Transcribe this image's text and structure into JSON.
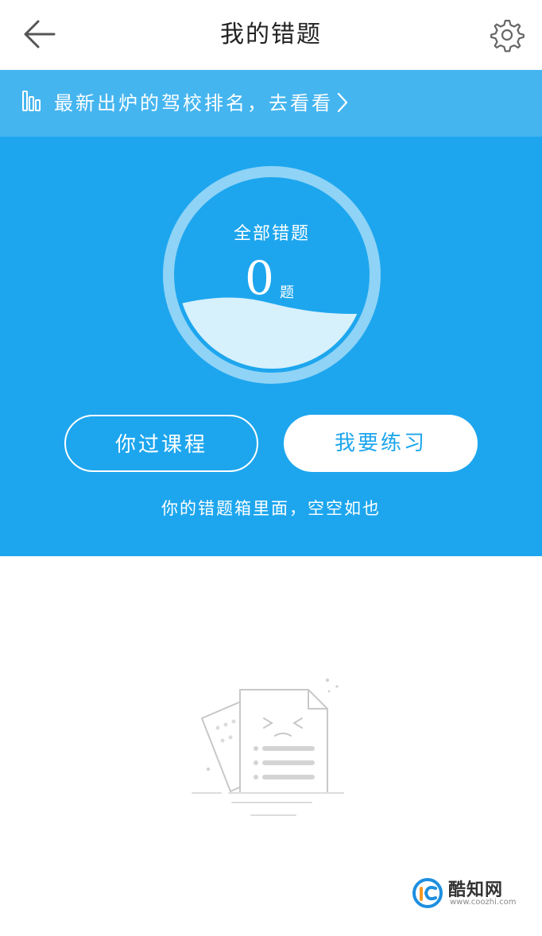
{
  "nav": {
    "title": "我的错题",
    "back_icon": "arrow-left-icon",
    "settings_icon": "gear-icon"
  },
  "banner": {
    "icon": "bar-chart-icon",
    "text": "最新出炉的驾校排名，去看看",
    "chevron_icon": "chevron-right-icon"
  },
  "summary": {
    "label": "全部错题",
    "count": "0",
    "unit": "题"
  },
  "actions": {
    "review_label": "你过课程",
    "practice_label": "我要练习"
  },
  "empty_hint": "你的错题箱里面，空空如也",
  "watermark": {
    "name": "酷知网",
    "url": "www.coozhi.com"
  },
  "colors": {
    "primary": "#1da6ee",
    "banner": "#45b5f0",
    "gauge_ring": "#8fd3f6",
    "wave": "#d6f0fc"
  }
}
